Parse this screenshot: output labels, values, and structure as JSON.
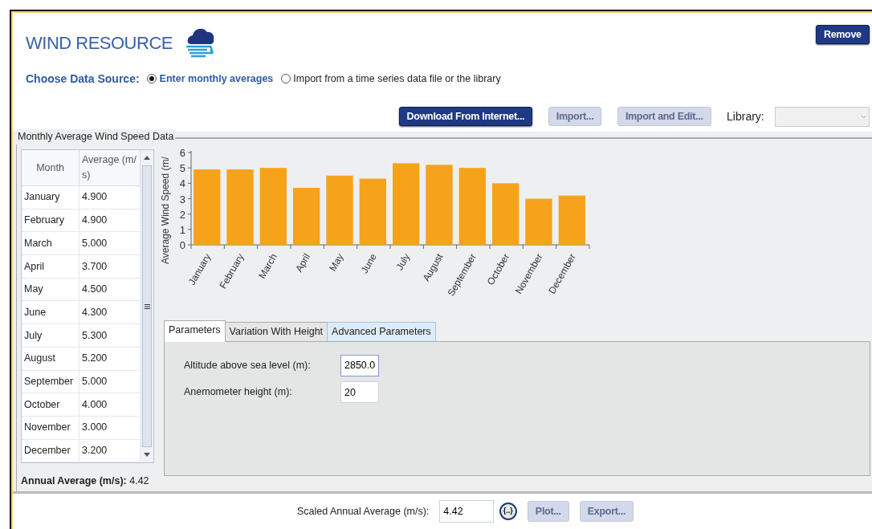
{
  "header": {
    "title": "WIND RESOURCE",
    "remove_button": "Remove"
  },
  "data_source": {
    "label": "Choose Data Source:",
    "options": [
      {
        "label": "Enter monthly averages",
        "selected": true
      },
      {
        "label": "Import from a time series data file or the library",
        "selected": false
      }
    ]
  },
  "toolbar": {
    "buttons": [
      {
        "label": "Download From Internet...",
        "disabled": false
      },
      {
        "label": "Import...",
        "disabled": true
      },
      {
        "label": "Import and Edit...",
        "disabled": true
      }
    ],
    "library_label": "Library:"
  },
  "monthly_data": {
    "title": "Monthly Average Wind Speed Data",
    "table": {
      "columns": [
        "Month",
        "Average (m/ s)"
      ],
      "rows": [
        [
          "January",
          "4.900"
        ],
        [
          "February",
          "4.900"
        ],
        [
          "March",
          "5.000"
        ],
        [
          "April",
          "3.700"
        ],
        [
          "May",
          "4.500"
        ],
        [
          "June",
          "4.300"
        ],
        [
          "July",
          "5.300"
        ],
        [
          "August",
          "5.200"
        ],
        [
          "September",
          "5.000"
        ],
        [
          "October",
          "4.000"
        ],
        [
          "November",
          "3.000"
        ],
        [
          "December",
          "3.200"
        ]
      ]
    },
    "annual_average": {
      "label": "Annual Average (m/s):",
      "value": "4.42"
    },
    "chart_data": {
      "type": "bar",
      "ylabel": "Average Wind Speed (m/",
      "categories": [
        "January",
        "February",
        "March",
        "April",
        "May",
        "June",
        "July",
        "August",
        "September",
        "October",
        "November",
        "December"
      ],
      "series": [
        {
          "color": "#f7a21b",
          "values": [
            4.9,
            4.9,
            5.0,
            3.7,
            4.5,
            4.3,
            5.3,
            5.2,
            5.0,
            4.0,
            3.0,
            3.2
          ]
        }
      ],
      "ylim": [
        0,
        6
      ],
      "yticks": [
        0,
        1,
        2,
        3,
        4,
        5,
        6
      ]
    },
    "tabs": [
      {
        "label": "Parameters",
        "selected": true,
        "hovered": false
      },
      {
        "label": "Variation With Height",
        "selected": false,
        "hovered": false
      },
      {
        "label": "Advanced Parameters",
        "selected": false,
        "hovered": true
      }
    ],
    "fields": [
      {
        "label": "Altitude above sea level (m):",
        "value": "2850.0",
        "focused": true
      },
      {
        "label": "Anemometer height (m):",
        "value": "20",
        "focused": false
      }
    ]
  },
  "footer": {
    "label": "Scaled Annual Average (m/s):",
    "value": "4.42",
    "buttons": [
      {
        "label": "{..}",
        "kind": "round",
        "disabled": false
      },
      {
        "label": "Plot...",
        "kind": "plain",
        "disabled": true
      },
      {
        "label": "Export...",
        "kind": "plain",
        "disabled": true
      }
    ]
  }
}
